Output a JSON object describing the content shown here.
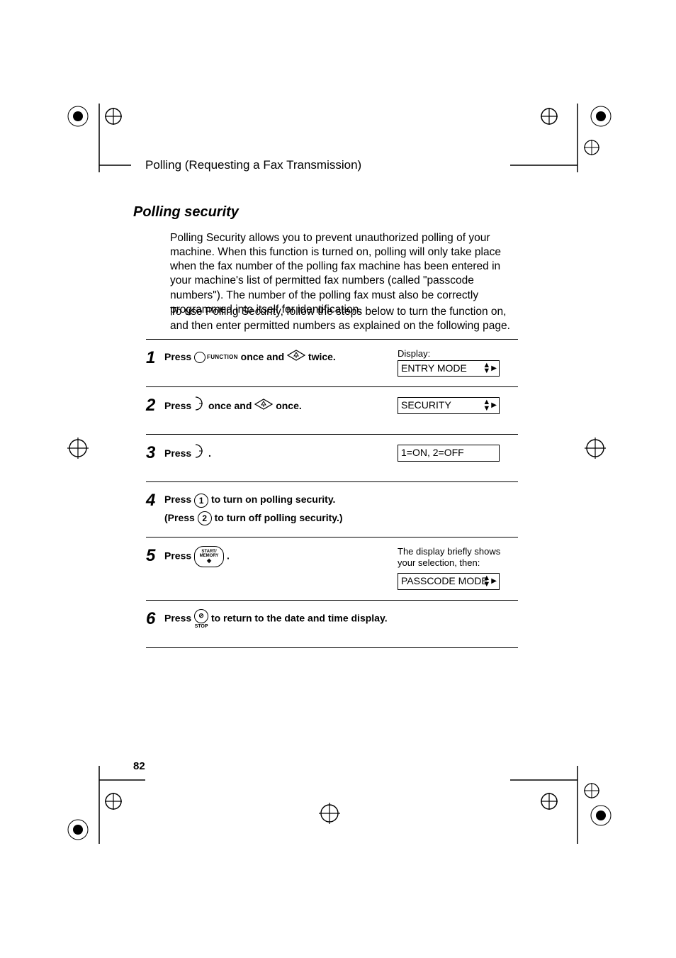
{
  "header": "Polling (Requesting a Fax Transmission)",
  "sectionTitle": "Polling security",
  "para1": "Polling Security allows you to prevent unauthorized polling of your machine. When this function is turned on, polling will only take place when the fax number of the polling fax machine has been entered in your machine's list of permitted fax numbers (called \"passcode numbers\"). The number of the polling fax must also be correctly programmed into itself for identification.",
  "para2": "To use Polling Security, follow the steps below to turn the function on, and then enter permitted numbers as explained on the following page.",
  "displayLabel": "Display:",
  "steps": {
    "s1": {
      "num": "1",
      "a": "Press",
      "funcLabel": "FUNCTION",
      "b": "once and",
      "c": "twice.",
      "lcd": "ENTRY MODE"
    },
    "s2": {
      "num": "2",
      "a": "Press",
      "b": "once and",
      "c": "once.",
      "lcd": "SECURITY"
    },
    "s3": {
      "num": "3",
      "a": "Press",
      "b": ".",
      "lcd": "1=ON, 2=OFF"
    },
    "s4": {
      "num": "4",
      "a": "Press",
      "key1": "1",
      "b": "to turn on polling security.",
      "c": "(Press",
      "key2": "2",
      "d": "to turn off polling security.)"
    },
    "s5": {
      "num": "5",
      "a": "Press",
      "startLine1": "START/",
      "startLine2": "MEMORY",
      "b": ".",
      "note": "The display briefly shows your selection, then:",
      "lcd": "PASSCODE MODE"
    },
    "s6": {
      "num": "6",
      "a": "Press",
      "stopLabel": "STOP",
      "b": "to return to the date and time display."
    }
  },
  "pageNumber": "82"
}
